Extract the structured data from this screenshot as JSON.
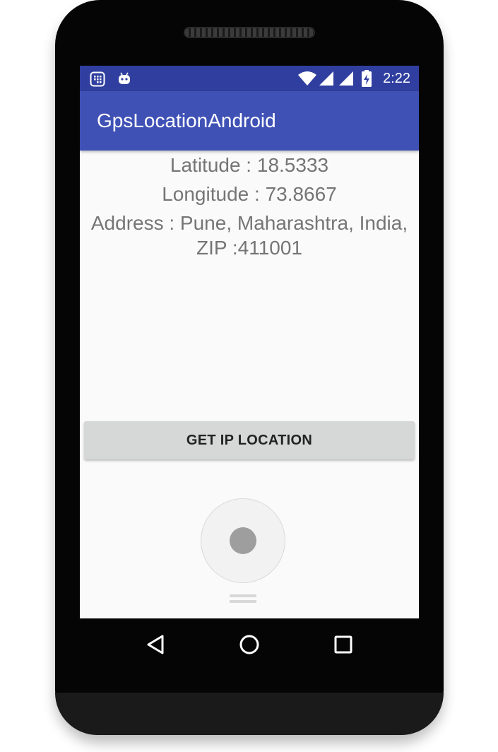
{
  "status_bar": {
    "time": "2:22",
    "icons": [
      "notification-grid-icon",
      "android-robot-icon",
      "wifi-icon",
      "cell-signal-icon",
      "cell-signal-2-icon",
      "battery-charging-icon"
    ]
  },
  "app_bar": {
    "title": "GpsLocationAndroid"
  },
  "content": {
    "latitude": "Latitude : 18.5333",
    "longitude": "Longitude : 73.8667",
    "address_line1": "Address : Pune, Maharashtra, India,",
    "address_line2": "ZIP :411001"
  },
  "button": {
    "label": "GET IP LOCATION"
  },
  "navbar": {
    "icons": [
      "back-icon",
      "home-icon",
      "recents-icon"
    ]
  },
  "colors": {
    "status_bar": "#303f9f",
    "app_bar": "#3f51b5",
    "text": "#757575",
    "button": "#d6d7d7"
  }
}
